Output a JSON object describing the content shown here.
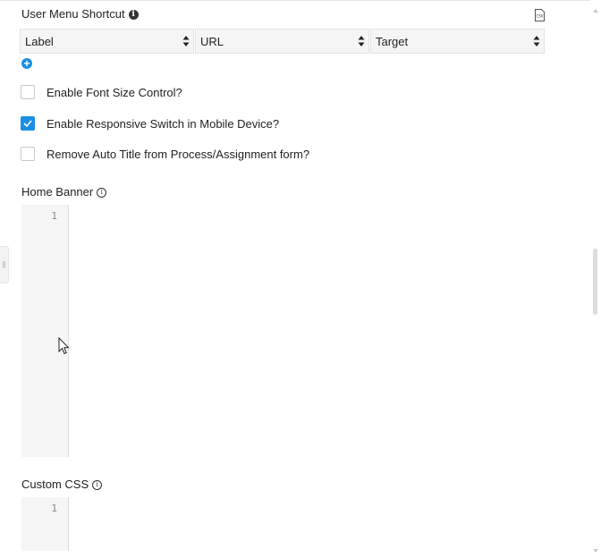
{
  "user_menu_shortcut": {
    "title": "User Menu Shortcut",
    "columns": [
      "Label",
      "URL",
      "Target"
    ],
    "add_icon": "plus-circle-icon",
    "csv_icon": "csv-file-icon",
    "csv_icon_text": "CSV"
  },
  "options": [
    {
      "label": "Enable Font Size Control?",
      "checked": false
    },
    {
      "label": "Enable Responsive Switch in Mobile Device?",
      "checked": true
    },
    {
      "label": "Remove Auto Title from Process/Assignment form?",
      "checked": false
    }
  ],
  "home_banner": {
    "label": "Home Banner",
    "line_number": "1"
  },
  "custom_css": {
    "label": "Custom CSS",
    "line_number": "1"
  },
  "colors": {
    "accent": "#1a8fe3"
  }
}
